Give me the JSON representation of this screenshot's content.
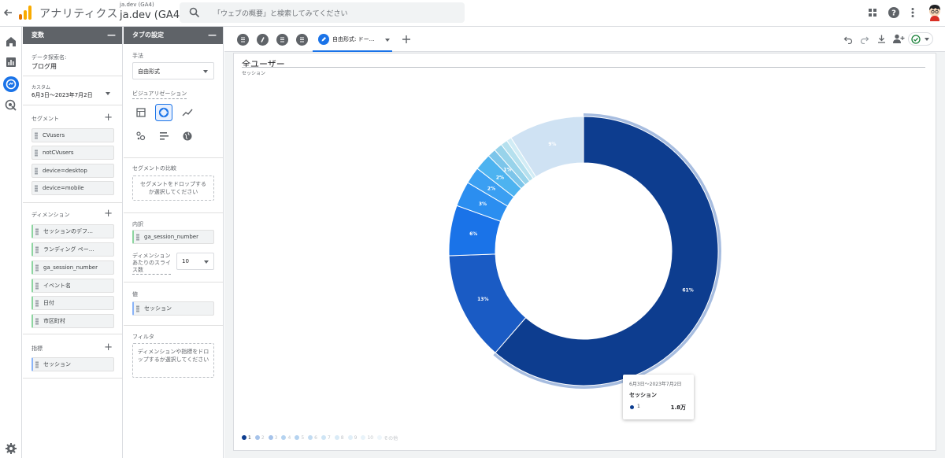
{
  "topbar": {
    "app_name": "アナリティクス",
    "account_small": "ja.dev (GA4)",
    "account_big": "ja.dev (GA4)",
    "search_placeholder": "「ウェブの概要」と検索してみてください"
  },
  "variables_panel": {
    "title": "変数",
    "exploration_label": "データ探索名:",
    "exploration_name": "ブログ用",
    "date_label": "カスタム",
    "date_range": "6月3日～2023年7月2日",
    "segments_label": "セグメント",
    "segments": [
      "CVusers",
      "notCVusers",
      "device=desktop",
      "device=mobile"
    ],
    "dimensions_label": "ディメンション",
    "dimensions": [
      "セッションのデフ…",
      "ランディング ペー…",
      "ga_session_number",
      "イベント名",
      "日付",
      "市区町村"
    ],
    "metrics_label": "指標",
    "metrics": [
      "セッション"
    ]
  },
  "settings_panel": {
    "title": "タブの設定",
    "technique_label": "手法",
    "technique_value": "自由形式",
    "viz_label": "ビジュアリゼーション",
    "segment_compare_label": "セグメントの比較",
    "segment_drop_text": "セグメントをドロップするか選択してください",
    "breakdown_label": "内訳",
    "breakdown_value": "ga_session_number",
    "slices_label": "ディメンションあたりのスライス数",
    "slices_value": "10",
    "values_label": "値",
    "values_value": "セッション",
    "filter_label": "フィルタ",
    "filter_drop_text": "ディメンションや指標をドロップするか選択してください"
  },
  "tabs": {
    "active_label": "自由形式: ドー…"
  },
  "chart_card": {
    "title": "全ユーザー",
    "subtitle": "セッション"
  },
  "tooltip": {
    "date": "6月3日～2023年7月2日",
    "metric": "セッション",
    "key": "1",
    "value": "1.8万"
  },
  "chart_data": {
    "type": "pie",
    "variant": "donut",
    "categories": [
      "1",
      "2",
      "3",
      "4",
      "5",
      "6",
      "7",
      "8",
      "9",
      "10",
      "その他"
    ],
    "values": [
      61,
      13,
      6,
      3,
      2,
      2,
      1,
      1,
      0.8,
      0.6,
      9
    ],
    "data_labels": [
      "61%",
      "13%",
      "6%",
      "3%",
      "2%",
      "2%",
      "1%",
      "",
      "",
      "",
      "9%"
    ],
    "colors": [
      "#0d3d8f",
      "#1a5bc4",
      "#1a73e8",
      "#2b8ef0",
      "#3b9ff2",
      "#4db3f0",
      "#7cc5ea",
      "#98d3ea",
      "#b5e0ee",
      "#d1ecf5",
      "#cfe2f3"
    ],
    "legend_position": "bottom-left"
  },
  "colors": {
    "accent": "#1a73e8",
    "panel_header": "#5f6368"
  }
}
